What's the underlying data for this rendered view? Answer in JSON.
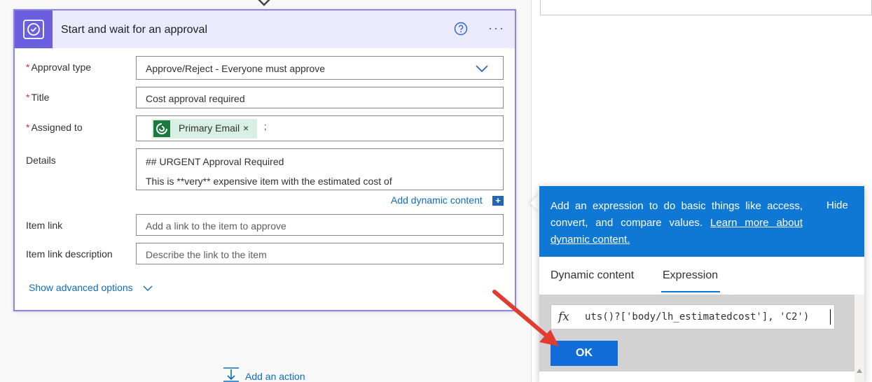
{
  "card": {
    "title": "Start and wait for an approval",
    "more_label": "···"
  },
  "fields": {
    "approval_type": {
      "label": "Approval type",
      "value": "Approve/Reject - Everyone must approve"
    },
    "title": {
      "label": "Title",
      "value": "Cost approval required"
    },
    "assigned_to": {
      "label": "Assigned to",
      "token": "Primary Email",
      "token_remove": "×",
      "separator": ";"
    },
    "details": {
      "label": "Details",
      "line1": "## URGENT Approval Required",
      "line2": "This is **very** expensive item with the estimated cost of"
    },
    "item_link": {
      "label": "Item link",
      "placeholder": "Add a link to the item to approve"
    },
    "item_link_description": {
      "label": "Item link description",
      "placeholder": "Describe the link to the item"
    }
  },
  "required_mark": "*",
  "add_dynamic_content": "Add dynamic content",
  "add_dynamic_plus": "+",
  "show_advanced": "Show advanced options",
  "add_action": "Add an action",
  "popup": {
    "info_text": "Add an expression to do basic things like access, convert, and compare values.",
    "info_link": "Learn more about dynamic content.",
    "hide": "Hide",
    "tabs": [
      "Dynamic content",
      "Expression"
    ],
    "active_tab": "Expression",
    "fx": "fx",
    "expression": "uts()?['body/lh_estimatedcost'], 'C2')",
    "ok": "OK"
  },
  "colors": {
    "accent": "#6b5fe0",
    "header_bg": "#ebeafd",
    "link": "#0f6cbd",
    "info_band": "#0f78d4",
    "ok_button": "#0f6cd8",
    "annotation_arrow": "#e03c31"
  }
}
